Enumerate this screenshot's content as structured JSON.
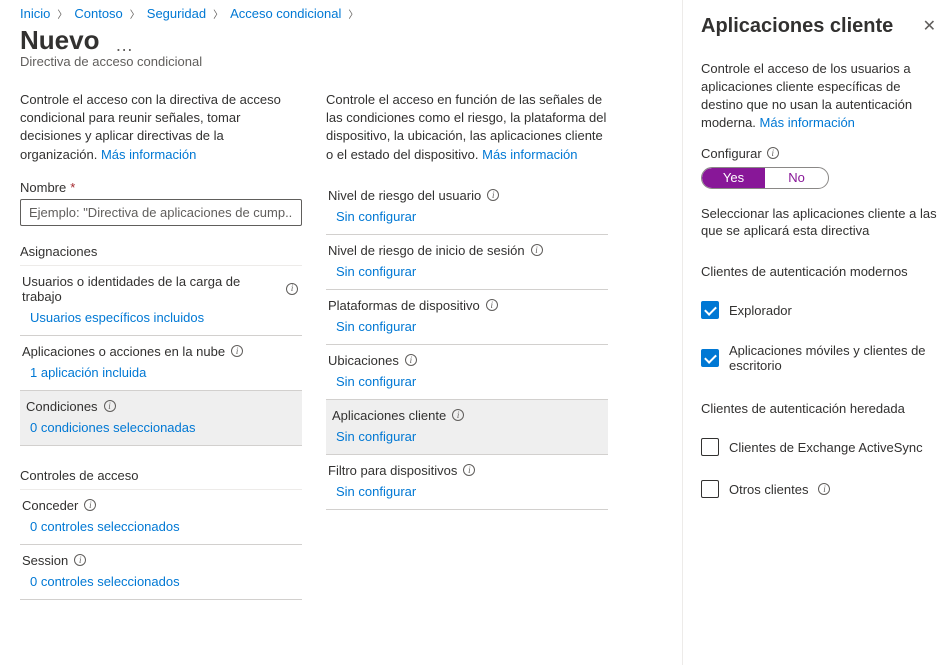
{
  "breadcrumb": {
    "items": [
      "Inicio",
      "Contoso",
      "Seguridad",
      "Acceso condicional"
    ]
  },
  "page": {
    "title": "Nuevo",
    "subtitle": "Directiva de acceso condicional"
  },
  "left": {
    "intro_text": "Controle el acceso con la directiva de acceso condicional para reunir señales, tomar decisiones y aplicar directivas de la organización. ",
    "intro_link": "Más información",
    "name_label": "Nombre",
    "name_placeholder": "Ejemplo: \"Directiva de aplicaciones de cump...",
    "assignments_label": "Asignaciones",
    "groups": {
      "users": {
        "head": "Usuarios o identidades de la carga de trabajo",
        "link": "Usuarios específicos incluidos"
      },
      "apps": {
        "head": "Aplicaciones o acciones en la nube",
        "link": "1 aplicación incluida"
      },
      "cond": {
        "head": "Condiciones",
        "link": "0 condiciones seleccionadas"
      }
    },
    "access_label": "Controles de acceso",
    "grant": {
      "head": "Conceder",
      "link": "0 controles seleccionados"
    },
    "session": {
      "head": "Session",
      "link": "0 controles seleccionados"
    }
  },
  "right": {
    "intro_text": "Controle el acceso en función de las señales de las condiciones como el riesgo, la plataforma del dispositivo, la ubicación, las aplicaciones cliente o el estado del dispositivo. ",
    "intro_link": "Más información",
    "groups": {
      "user_risk": {
        "head": "Nivel de riesgo del usuario",
        "link": "Sin configurar"
      },
      "signin_risk": {
        "head": "Nivel de riesgo de inicio de sesión",
        "link": "Sin configurar"
      },
      "platforms": {
        "head": "Plataformas de dispositivo",
        "link": "Sin configurar"
      },
      "locations": {
        "head": "Ubicaciones",
        "link": "Sin configurar"
      },
      "client_apps": {
        "head": "Aplicaciones cliente",
        "link": "Sin configurar"
      },
      "device_filter": {
        "head": "Filtro para dispositivos",
        "link": "Sin configurar"
      }
    }
  },
  "panel": {
    "title": "Aplicaciones cliente",
    "text": "Controle el acceso de los usuarios a aplicaciones cliente específicas de destino que no usan la autenticación moderna. ",
    "link": "Más información",
    "configure_label": "Configurar",
    "toggle_yes": "Yes",
    "toggle_no": "No",
    "select_text": "Seleccionar las aplicaciones cliente a las que se aplicará esta directiva",
    "modern_head": "Clientes de autenticación modernos",
    "cb_browser": "Explorador",
    "cb_mobile": "Aplicaciones móviles y clientes de escritorio",
    "legacy_head": "Clientes de autenticación heredada",
    "cb_eas": "Clientes de Exchange ActiveSync",
    "cb_other": "Otros clientes"
  }
}
